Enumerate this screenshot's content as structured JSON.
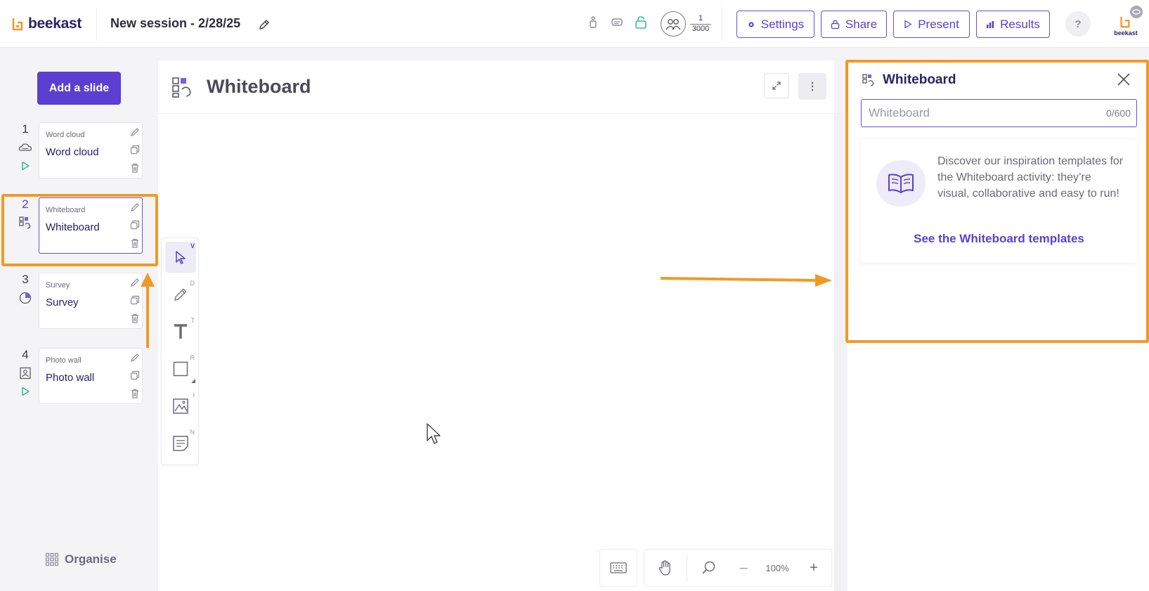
{
  "app": {
    "brand": "beekast",
    "session_title": "New session - 2/28/25"
  },
  "participants": {
    "current": "1",
    "max": "3000"
  },
  "toolbar_buttons": {
    "settings": "Settings",
    "share": "Share",
    "present": "Present",
    "results": "Results",
    "help": "?"
  },
  "sidebar": {
    "add_slide": "Add a slide",
    "organise": "Organise",
    "slides": [
      {
        "number": "1",
        "kind": "Word cloud",
        "title": "Word cloud",
        "icon": "cloud-icon",
        "playable": true
      },
      {
        "number": "2",
        "kind": "Whiteboard",
        "title": "Whiteboard",
        "icon": "whiteboard-icon",
        "playable": false
      },
      {
        "number": "3",
        "kind": "Survey",
        "title": "Survey",
        "icon": "pie-chart-icon",
        "playable": false
      },
      {
        "number": "4",
        "kind": "Photo wall",
        "title": "Photo wall",
        "icon": "photo-wall-icon",
        "playable": true
      }
    ]
  },
  "main": {
    "title": "Whiteboard"
  },
  "tools": [
    {
      "name": "select",
      "key": "V"
    },
    {
      "name": "pencil",
      "key": "D"
    },
    {
      "name": "text",
      "key": "T"
    },
    {
      "name": "rectangle",
      "key": "R"
    },
    {
      "name": "image",
      "key": "I"
    },
    {
      "name": "note",
      "key": "N"
    }
  ],
  "zoom": {
    "level": "100%",
    "minus": "–",
    "plus": "+"
  },
  "panel": {
    "title": "Whiteboard",
    "input_placeholder": "Whiteboard",
    "input_value": "",
    "char_count": "0/600",
    "template_text": "Discover our inspiration templates for the Whiteboard activity: they’re visual, collaborative and easy to run!",
    "template_link": "See the Whiteboard templates"
  },
  "colors": {
    "accent": "#5a3fd0",
    "annotation": "#f09a26",
    "brand_dark": "#2a2560"
  }
}
